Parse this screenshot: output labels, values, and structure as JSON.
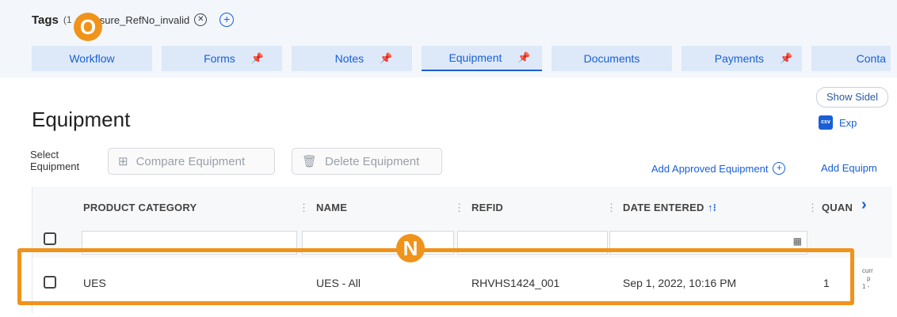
{
  "tags": {
    "label": "Tags",
    "count": "(1",
    "chip": "asure_RefNo_invalid"
  },
  "tabs": [
    {
      "label": "Workflow"
    },
    {
      "label": "Forms"
    },
    {
      "label": "Notes"
    },
    {
      "label": "Equipment"
    },
    {
      "label": "Documents"
    },
    {
      "label": "Payments"
    },
    {
      "label": "Conta"
    }
  ],
  "show_sidebar": "Show Sidel",
  "page_title": "Equipment",
  "export_label": "Exp",
  "export_icon": "csv",
  "select_label_1": "Select",
  "select_label_2": "Equipment",
  "buttons": {
    "compare": "Compare Equipment",
    "delete": "Delete Equipment"
  },
  "add_approved": "Add Approved Equipment",
  "add_equipment": "Add Equipm",
  "columns": [
    "PRODUCT CATEGORY",
    "NAME",
    "REFID",
    "DATE ENTERED",
    "QUAN"
  ],
  "row": {
    "category": "UES",
    "name": "UES - All",
    "refid": "RHVHS1424_001",
    "date": "Sep 1, 2022, 10:16 PM",
    "quantity": "1"
  },
  "side_text": [
    "curr",
    "p",
    "1 -"
  ],
  "markers": {
    "tags": "O",
    "row": "N"
  },
  "accent_color": "#1a5fd6",
  "marker_color": "#f0931a"
}
